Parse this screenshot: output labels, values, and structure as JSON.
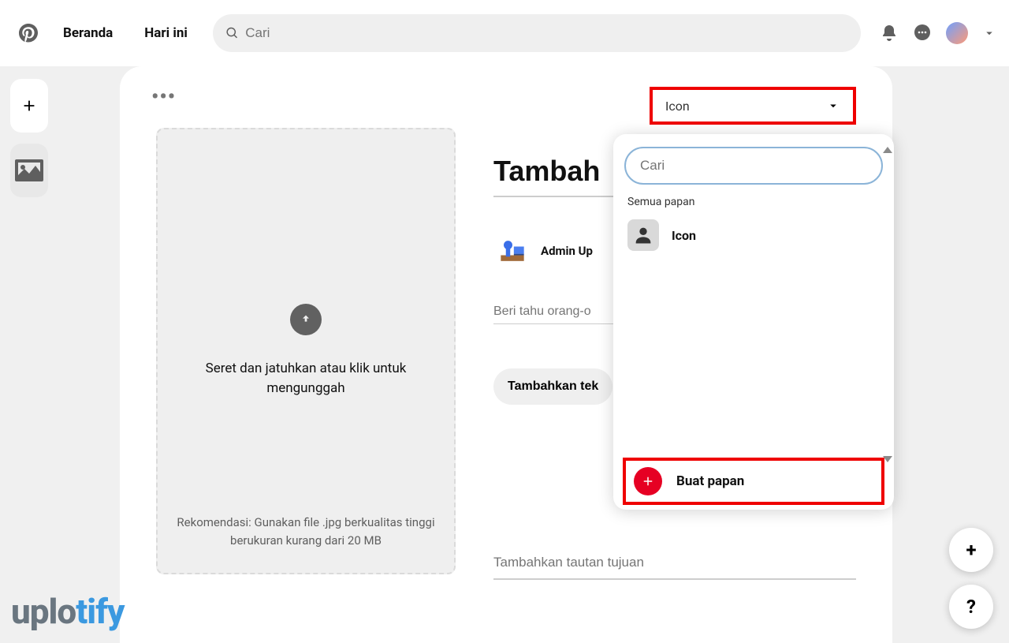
{
  "header": {
    "nav": [
      "Beranda",
      "Hari ini"
    ],
    "search_placeholder": "Cari"
  },
  "board_selector": {
    "selected": "Icon"
  },
  "dropdown": {
    "search_placeholder": "Cari",
    "section_label": "Semua papan",
    "items": [
      {
        "name": "Icon"
      }
    ],
    "create_label": "Buat papan"
  },
  "form": {
    "title_placeholder": "Tambah",
    "author": "Admin Up",
    "desc_placeholder": "Beri tahu orang-o",
    "alt_button": "Tambahkan tek",
    "link_placeholder": "Tambahkan tautan tujuan"
  },
  "upload": {
    "main_text": "Seret dan jatuhkan atau klik untuk mengunggah",
    "hint": "Rekomendasi: Gunakan file .jpg berkualitas tinggi berukuran kurang dari 20 MB"
  },
  "watermark": {
    "a": "uplo",
    "b": "tify"
  },
  "fab": {
    "plus": "+",
    "help": "?"
  }
}
